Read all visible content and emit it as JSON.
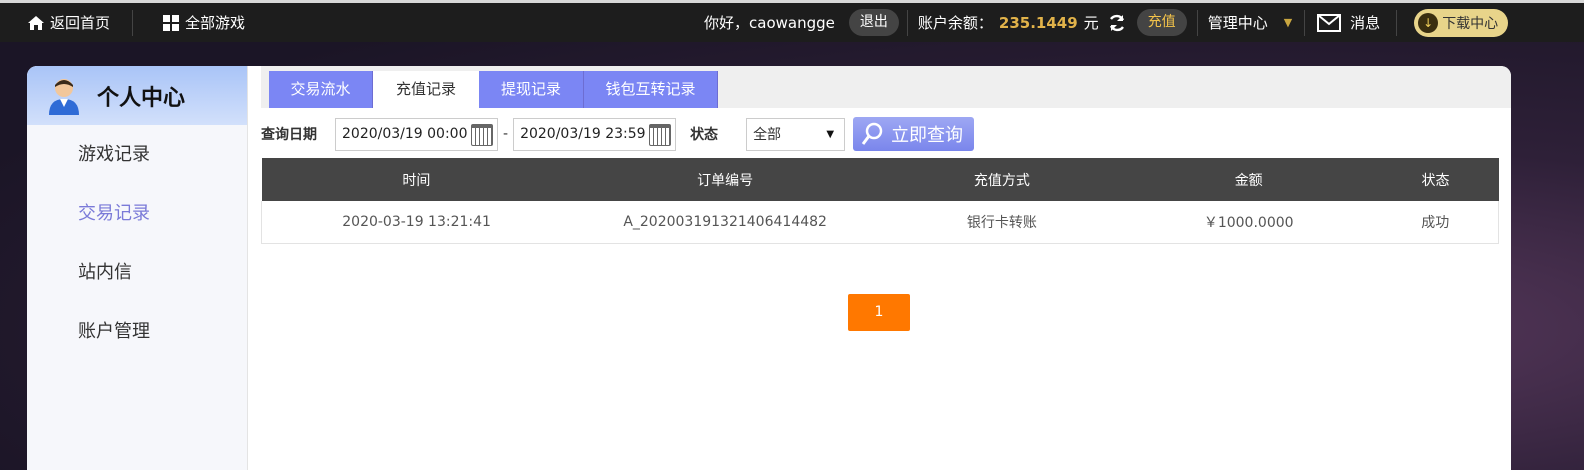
{
  "topbar": {
    "home_label": "返回首页",
    "games_label": "全部游戏",
    "greeting": "你好，caowangge",
    "logout_label": "退出",
    "balance_label": "账户余额：",
    "balance_value": "235.1449",
    "balance_unit": "元",
    "recharge_label": "充值",
    "manage_label": "管理中心",
    "message_label": "消息",
    "download_label": "下载中心"
  },
  "sidebar": {
    "title": "个人中心",
    "items": [
      {
        "label": "游戏记录"
      },
      {
        "label": "交易记录"
      },
      {
        "label": "站内信"
      },
      {
        "label": "账户管理"
      }
    ]
  },
  "tabs": [
    {
      "label": "交易流水"
    },
    {
      "label": "充值记录"
    },
    {
      "label": "提现记录"
    },
    {
      "label": "钱包互转记录"
    }
  ],
  "filter": {
    "date_label": "查询日期",
    "start_date": "2020/03/19 00:00",
    "dash": "-",
    "end_date": "2020/03/19 23:59",
    "status_label": "状态",
    "status_value": "全部",
    "query_label": "立即查询"
  },
  "table": {
    "headers": [
      "时间",
      "订单编号",
      "充值方式",
      "金额",
      "状态"
    ],
    "rows": [
      [
        "2020-03-19 13:21:41",
        "A_20200319132140641​4482",
        "银行卡转账",
        "￥1000.0000",
        "成功"
      ]
    ]
  },
  "pagination": {
    "current": "1"
  },
  "colors": {
    "accent": "#7b86f4",
    "pager": "#ff7800",
    "balance": "#e2b34a"
  }
}
